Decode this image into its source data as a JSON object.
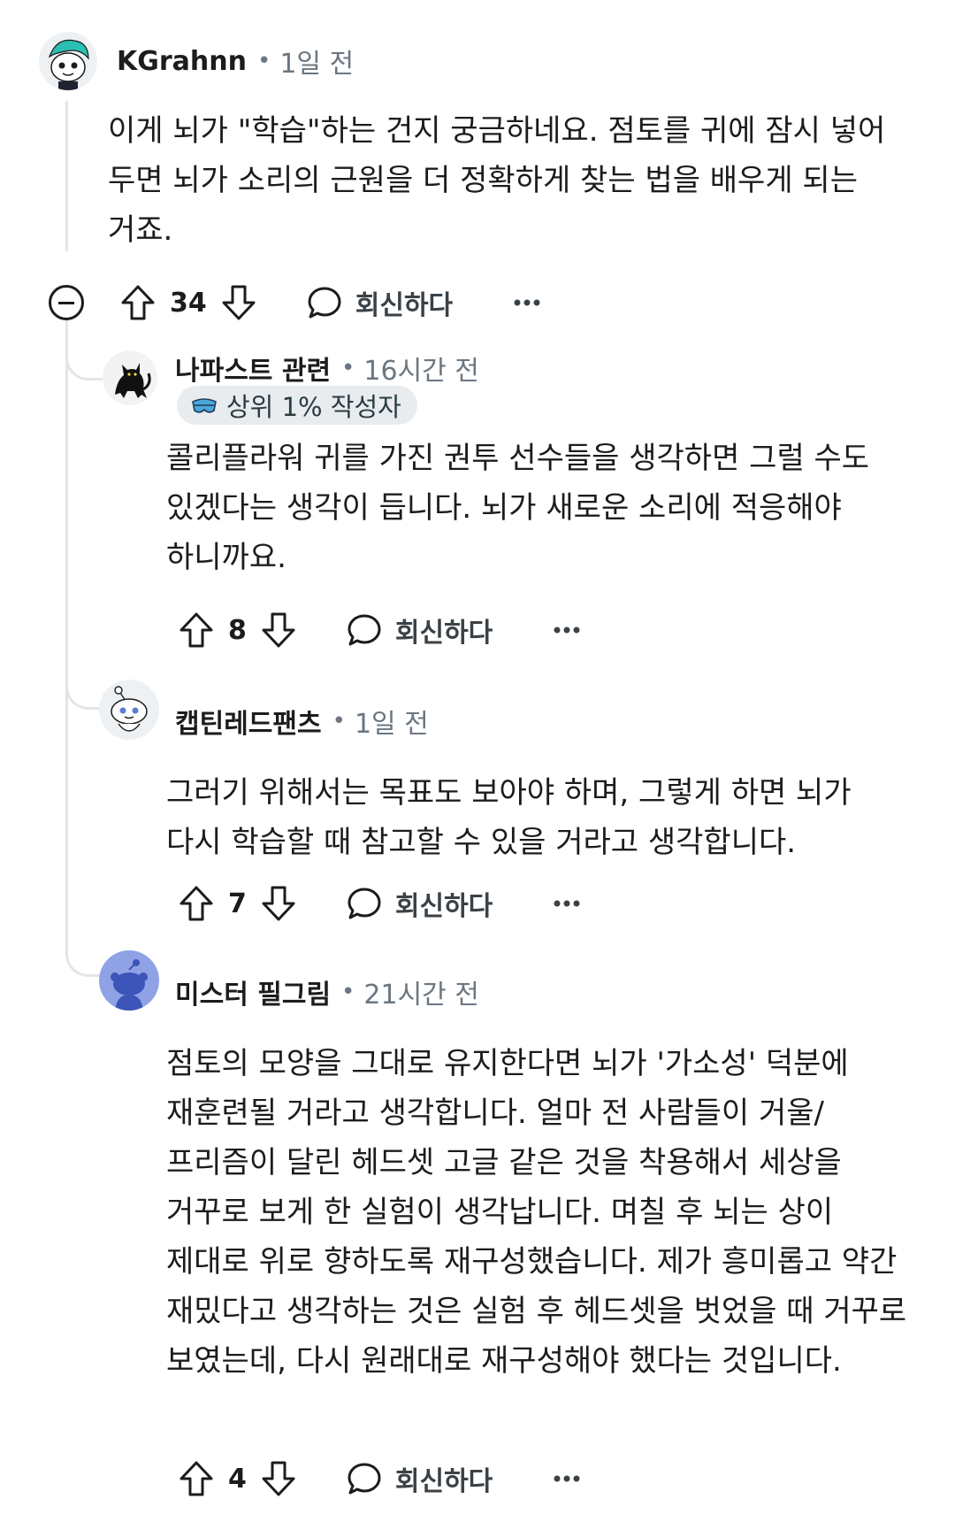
{
  "comments": [
    {
      "username": "KGrahnn",
      "time": "1일 전",
      "body": "이게 뇌가 \"학습\"하는 건지 궁금하네요. 점토를 귀에 잠시 넣어 두면 뇌가 소리의 근원을 더 정확하게 찾는 법을 배우게 되는 거죠.",
      "votes": "34",
      "reply_label": "회신하다",
      "avatar_icon": "snoo-avatar-teal-hair"
    },
    {
      "username": "나파스트 관련",
      "time": "16시간 전",
      "badge": "상위 1% 작성자",
      "body": "콜리플라워 귀를 가진 권투 선수들을 생각하면 그럴 수도 있겠다는 생각이 듭니다. 뇌가 새로운 소리에 적응해야 하니까요.",
      "votes": "8",
      "reply_label": "회신하다",
      "avatar_icon": "black-cat-avatar"
    },
    {
      "username": "캡틴레드팬츠",
      "time": "1일 전",
      "body": "그러기 위해서는 목표도 보아야 하며, 그렇게 하면 뇌가 다시 학습할 때 참고할 수 있을 거라고 생각합니다.",
      "votes": "7",
      "reply_label": "회신하다",
      "avatar_icon": "snoo-avatar-white"
    },
    {
      "username": "미스터 필그림",
      "time": "21시간 전",
      "body": "점토의 모양을 그대로 유지한다면 뇌가 '가소성' 덕분에 재훈련될 거라고 생각합니다. 얼마 전 사람들이 거울/프리즘이 달린 헤드셋 고글 같은 것을 착용해서 세상을 거꾸로 보게 한 실험이 생각납니다. 며칠 후 뇌는 상이 제대로 위로 향하도록 재구성했습니다. 제가 흥미롭고 약간 재밌다고 생각하는 것은 실험 후 헤드셋을 벗었을 때 거꾸로 보였는데, 다시 원래대로 재구성해야 했다는 것입니다.",
      "votes": "4",
      "reply_label": "회신하다",
      "avatar_icon": "default-snoo-avatar-blue"
    }
  ],
  "colors": {
    "text": "#1c1c1c",
    "meta": "#6b7680",
    "thread_line": "#e3e5e8",
    "badge_bg": "#e9ecef",
    "avatar_blue": "#8fa2e6"
  }
}
